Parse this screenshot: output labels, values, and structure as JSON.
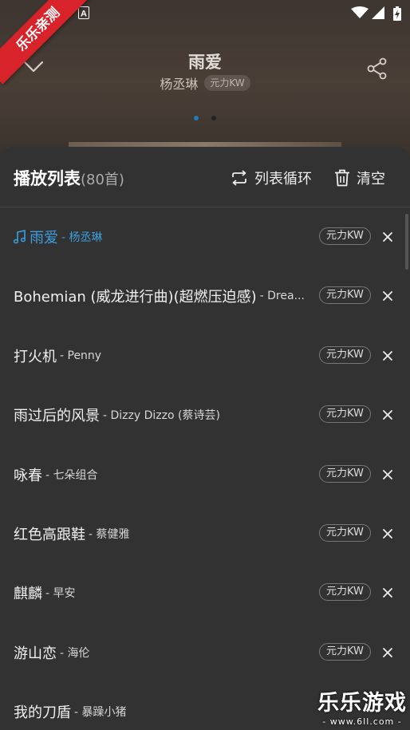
{
  "status_bar": {
    "icons": [
      "notification-a-icon",
      "wifi-icon",
      "signal-icon",
      "battery-charging-icon"
    ]
  },
  "ribbon": {
    "text": "乐乐亲测"
  },
  "player": {
    "title": "雨爱",
    "artist": "杨丞琳",
    "source": "元力KW",
    "pages": 2,
    "active_page": 1
  },
  "playlist": {
    "title": "播放列表",
    "count": "(80首)",
    "loop_label": "列表循环",
    "clear_label": "清空",
    "items": [
      {
        "name": "雨爱",
        "artist": "- 杨丞琳",
        "source": "元力KW",
        "playing": true
      },
      {
        "name": "Bohemian (威龙进行曲)(超燃压迫感)",
        "artist": "- Drea...",
        "source": "元力KW",
        "playing": false
      },
      {
        "name": "打火机",
        "artist": "- Penny",
        "source": "元力KW",
        "playing": false
      },
      {
        "name": "雨过后的风景",
        "artist": "- Dizzy Dizzo (蔡诗芸)",
        "source": "元力KW",
        "playing": false
      },
      {
        "name": "咏春",
        "artist": "- 七朵组合",
        "source": "元力KW",
        "playing": false
      },
      {
        "name": "红色高跟鞋",
        "artist": "- 蔡健雅",
        "source": "元力KW",
        "playing": false
      },
      {
        "name": "麒麟",
        "artist": "- 早安",
        "source": "元力KW",
        "playing": false
      },
      {
        "name": "游山恋",
        "artist": "- 海伦",
        "source": "元力KW",
        "playing": false
      },
      {
        "name": "我的刀盾",
        "artist": "- 暴躁小猪",
        "source": "",
        "playing": false
      }
    ]
  },
  "watermark": {
    "main": "乐乐游戏",
    "url": "- www.6ll.com -"
  },
  "colors": {
    "accent": "#3a9fe0",
    "ribbon": "#d8232a",
    "sheet": "#323232"
  }
}
